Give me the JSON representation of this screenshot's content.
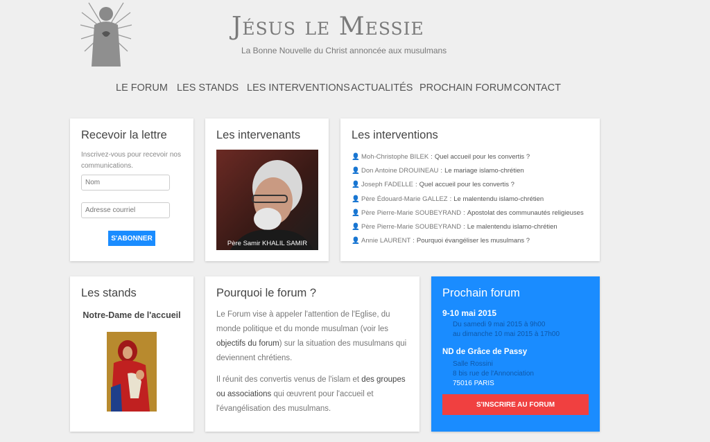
{
  "header": {
    "title": "Jésus le Messie",
    "tagline": "La Bonne Nouvelle du Christ annoncée aux musulmans"
  },
  "nav": {
    "items": [
      {
        "label": "LE FORUM"
      },
      {
        "label": "LES STANDS"
      },
      {
        "label": "LES INTERVENTIONS"
      },
      {
        "label": "ACTUALITÉS"
      },
      {
        "label": "PROCHAIN FORUM"
      },
      {
        "label": "CONTACT"
      }
    ]
  },
  "newsletter": {
    "title": "Recevoir la lettre",
    "description": "Inscrivez-vous pour recevoir nos communications.",
    "name_placeholder": "Nom",
    "email_placeholder": "Adresse courriel",
    "subscribe_label": "S'ABONNER"
  },
  "speakers": {
    "title": "Les intervenants",
    "caption": "Père Samir KHALIL SAMIR"
  },
  "interventions": {
    "title": "Les interventions",
    "items": [
      {
        "speaker": "Moh-Christophe BILEK",
        "topic": "Quel accueil pour les convertis ?"
      },
      {
        "speaker": "Don Antoine DROUINEAU",
        "topic": "Le mariage islamo-chrétien"
      },
      {
        "speaker": "Joseph FADELLE",
        "topic": "Quel accueil pour les convertis ?"
      },
      {
        "speaker": "Père Édouard-Marie GALLEZ",
        "topic": "Le malentendu islamo-chrétien"
      },
      {
        "speaker": "Père Pierre-Marie SOUBEYRAND",
        "topic": "Apostolat des communautés religieuses"
      },
      {
        "speaker": "Père Pierre-Marie SOUBEYRAND",
        "topic": "Le malentendu islamo-chrétien"
      },
      {
        "speaker": "Annie LAURENT",
        "topic": "Pourquoi évangéliser les musulmans ?"
      }
    ]
  },
  "stands": {
    "title": "Les stands",
    "stand_name": "Notre-Dame de l'accueil"
  },
  "why": {
    "title": "Pourquoi le forum ?",
    "p1_a": "Le Forum vise à appeler l'attention de l'Eglise, du monde politique et du monde musulman (voir les ",
    "p1_link": "objectifs du forum",
    "p1_b": ") sur la situation des musulmans qui deviennent chrétiens.",
    "p2_a": "Il réunit des convertis venus de l'islam et ",
    "p2_link": "des groupes ou associations",
    "p2_b": " qui œuvrent pour l'accueil et l'évangélisation des musulmans."
  },
  "next_forum": {
    "title": "Prochain forum",
    "dates": "9-10 mai 2015",
    "from_line": "Du samedi 9 mai 2015 à 9h00",
    "to_line": "au dimanche 10 mai 2015 à 17h00",
    "place": "ND de Grâce de Passy",
    "room": "Salle Rossini",
    "street": "8 bis rue de l'Annonciation",
    "city": "75016 PARIS",
    "register_label": "S'INSCRIRE AU FORUM"
  },
  "colors": {
    "accent": "#1a8cff",
    "cta": "#f04040",
    "background": "#efefef"
  }
}
